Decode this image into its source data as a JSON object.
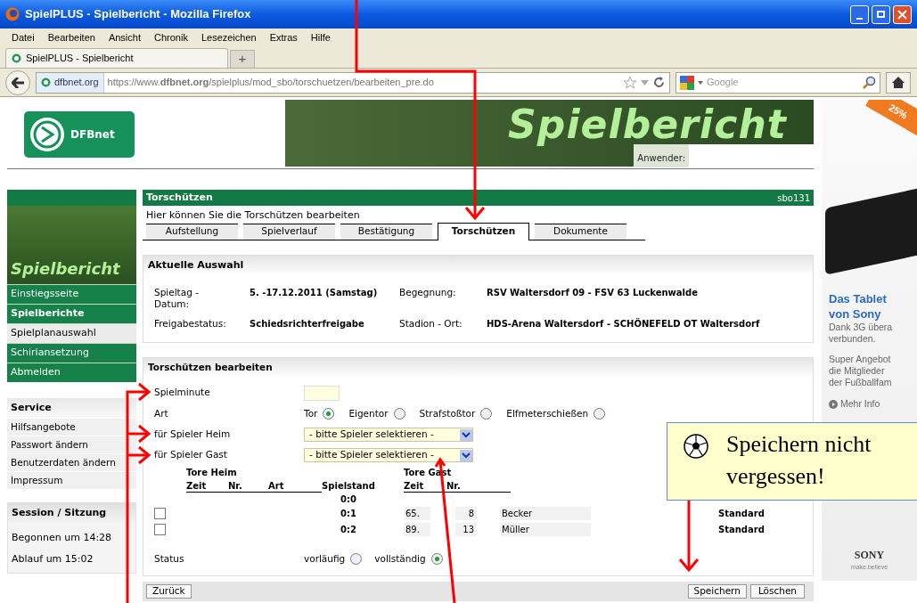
{
  "window": {
    "title": "SpielPLUS - Spielbericht - Mozilla Firefox"
  },
  "menu": [
    "Datei",
    "Bearbeiten",
    "Ansicht",
    "Chronik",
    "Lesezeichen",
    "Extras",
    "Hilfe"
  ],
  "browser_tab": {
    "label": "SpielPLUS - Spielbericht",
    "new_tab": "+"
  },
  "address": {
    "site": "dfbnet.org",
    "url": "https://www.**dfbnet.org**/spielplus/mod_sbo/torschuetzen/bearbeiten_pre.do"
  },
  "search": {
    "placeholder": "Google"
  },
  "header": {
    "logo": "DFBnet",
    "banner_title": "Spielbericht",
    "user_label": "Anwender:"
  },
  "sidebar": {
    "banner_title": "Spielbericht",
    "nav": [
      {
        "label": "Einstiegsseite",
        "active": false,
        "selected": false
      },
      {
        "label": "Spielberichte",
        "active": true,
        "selected": false
      },
      {
        "label": "Spielplanauswahl",
        "active": false,
        "selected": true
      },
      {
        "label": "Schiriansetzung",
        "active": false,
        "selected": false
      },
      {
        "label": "Abmelden",
        "active": false,
        "selected": false
      }
    ],
    "service": {
      "title": "Service",
      "items": [
        "Hilfsangebote",
        "Passwort ändern",
        "Benutzerdaten ändern",
        "Impressum"
      ]
    },
    "session": {
      "title": "Session / Sitzung",
      "lines": [
        "Begonnen um 14:28",
        "Ablauf um 15:02"
      ]
    }
  },
  "main": {
    "title": "Torschützen",
    "code": "sbo131",
    "intro": "Hier können Sie die Torschützen bearbeiten",
    "tabs": [
      {
        "label": "Aufstellung",
        "selected": false
      },
      {
        "label": "Spielverlauf",
        "selected": false
      },
      {
        "label": "Bestätigung",
        "selected": false
      },
      {
        "label": "Torschützen",
        "selected": true
      },
      {
        "label": "Dokumente",
        "selected": false
      }
    ],
    "selection": {
      "title": "Aktuelle Auswahl",
      "fields": [
        {
          "label": "Spieltag - Datum:",
          "value": "5. -17.12.2011 (Samstag)"
        },
        {
          "label": "Begegnung:",
          "value": "RSV Waltersdorf 09 - FSV 63 Luckenwalde"
        },
        {
          "label": "Freigabestatus:",
          "value": "Schiedsrichterfreigabe"
        },
        {
          "label": "Stadion - Ort:",
          "value": "HDS-Arena Waltersdorf - SCHÖNEFELD OT Waltersdorf"
        }
      ]
    },
    "form": {
      "title": "Torschützen bearbeiten",
      "minute": {
        "label": "Spielminute"
      },
      "art": {
        "label": "Art",
        "options": [
          {
            "label": "Tor",
            "selected": true
          },
          {
            "label": "Eigentor",
            "selected": false
          },
          {
            "label": "Strafstoßtor",
            "selected": false
          },
          {
            "label": "Elfmeterschießen",
            "selected": false
          }
        ]
      },
      "heim": {
        "label": "für Spieler Heim",
        "value": "- bitte Spieler selektieren -"
      },
      "gast": {
        "label": "für Spieler Gast",
        "value": "- bitte Spieler selektieren -"
      },
      "goals": {
        "heim_title": "Tore Heim",
        "heim_columns": [
          "Zeit",
          "Nr.",
          "Art"
        ],
        "score_column": "Spielstand",
        "gast_title": "Tore Gast",
        "gast_columns": [
          "Zeit",
          "Nr."
        ],
        "start_score": "0:0",
        "rows": [
          {
            "checked": false,
            "score": "0:1",
            "time": "65.",
            "number": "8",
            "name": "Becker",
            "type": "Standard"
          },
          {
            "checked": false,
            "score": "0:2",
            "time": "89.",
            "number": "13",
            "name": "Müller",
            "type": "Standard"
          }
        ]
      },
      "status": {
        "label": "Status",
        "options": [
          {
            "label": "vorläufig",
            "selected": false
          },
          {
            "label": "vollständig",
            "selected": true
          }
        ]
      }
    },
    "buttons": {
      "back": "Zurück",
      "save": "Speichern",
      "delete": "Löschen"
    }
  },
  "ad": {
    "badge": "25%",
    "headline": [
      "Das Tablet",
      "von Sony"
    ],
    "lines": [
      "Dank 3G übera",
      "verbunden.",
      "Super Angebot",
      "die Mitglieder",
      "der Fußballfam"
    ],
    "link": "Mehr Info",
    "brand": "SONY",
    "tagline": "make.believe"
  },
  "callout": {
    "text": "Speichern nicht vergessen!"
  }
}
